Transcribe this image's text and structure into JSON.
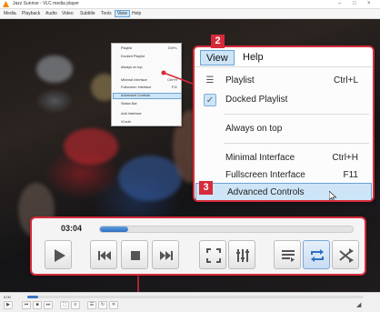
{
  "window": {
    "title": "Jazz Sunrise - VLC media player",
    "menus": [
      "Media",
      "Playback",
      "Audio",
      "Video",
      "Subtitle",
      "Tools",
      "View",
      "Help"
    ]
  },
  "small_menu": {
    "items": [
      {
        "label": "Playlist",
        "shortcut": "Ctrl+L"
      },
      {
        "label": "Docked Playlist",
        "shortcut": ""
      },
      {
        "label": "Always on top",
        "shortcut": ""
      },
      {
        "label": "Minimal Interface",
        "shortcut": "Ctrl+H"
      },
      {
        "label": "Fullscreen Interface",
        "shortcut": "F11"
      },
      {
        "label": "Advanced Controls",
        "shortcut": ""
      },
      {
        "label": "Status Bar",
        "shortcut": ""
      },
      {
        "label": "Add Interface",
        "shortcut": ""
      },
      {
        "label": "VLsub",
        "shortcut": ""
      }
    ]
  },
  "view_menu": {
    "menubar": {
      "view": "View",
      "help": "Help"
    },
    "items": {
      "playlist": {
        "label": "Playlist",
        "shortcut": "Ctrl+L"
      },
      "docked_playlist": {
        "label": "Docked Playlist"
      },
      "always_on_top": {
        "label": "Always on top"
      },
      "minimal": {
        "label": "Minimal Interface",
        "shortcut": "Ctrl+H"
      },
      "fullscreen": {
        "label": "Fullscreen Interface",
        "shortcut": "F11"
      },
      "advanced": {
        "label": "Advanced Controls"
      }
    }
  },
  "controls": {
    "time": "03:04",
    "progress_fraction": 0.11
  },
  "minibar": {
    "time": "0:00"
  },
  "badges": {
    "one": "1",
    "two": "2",
    "three": "3"
  },
  "colors": {
    "callout_red": "#d62a3a",
    "highlight_blue": "#cde5f7",
    "seek_blue": "#2f6fc2"
  }
}
